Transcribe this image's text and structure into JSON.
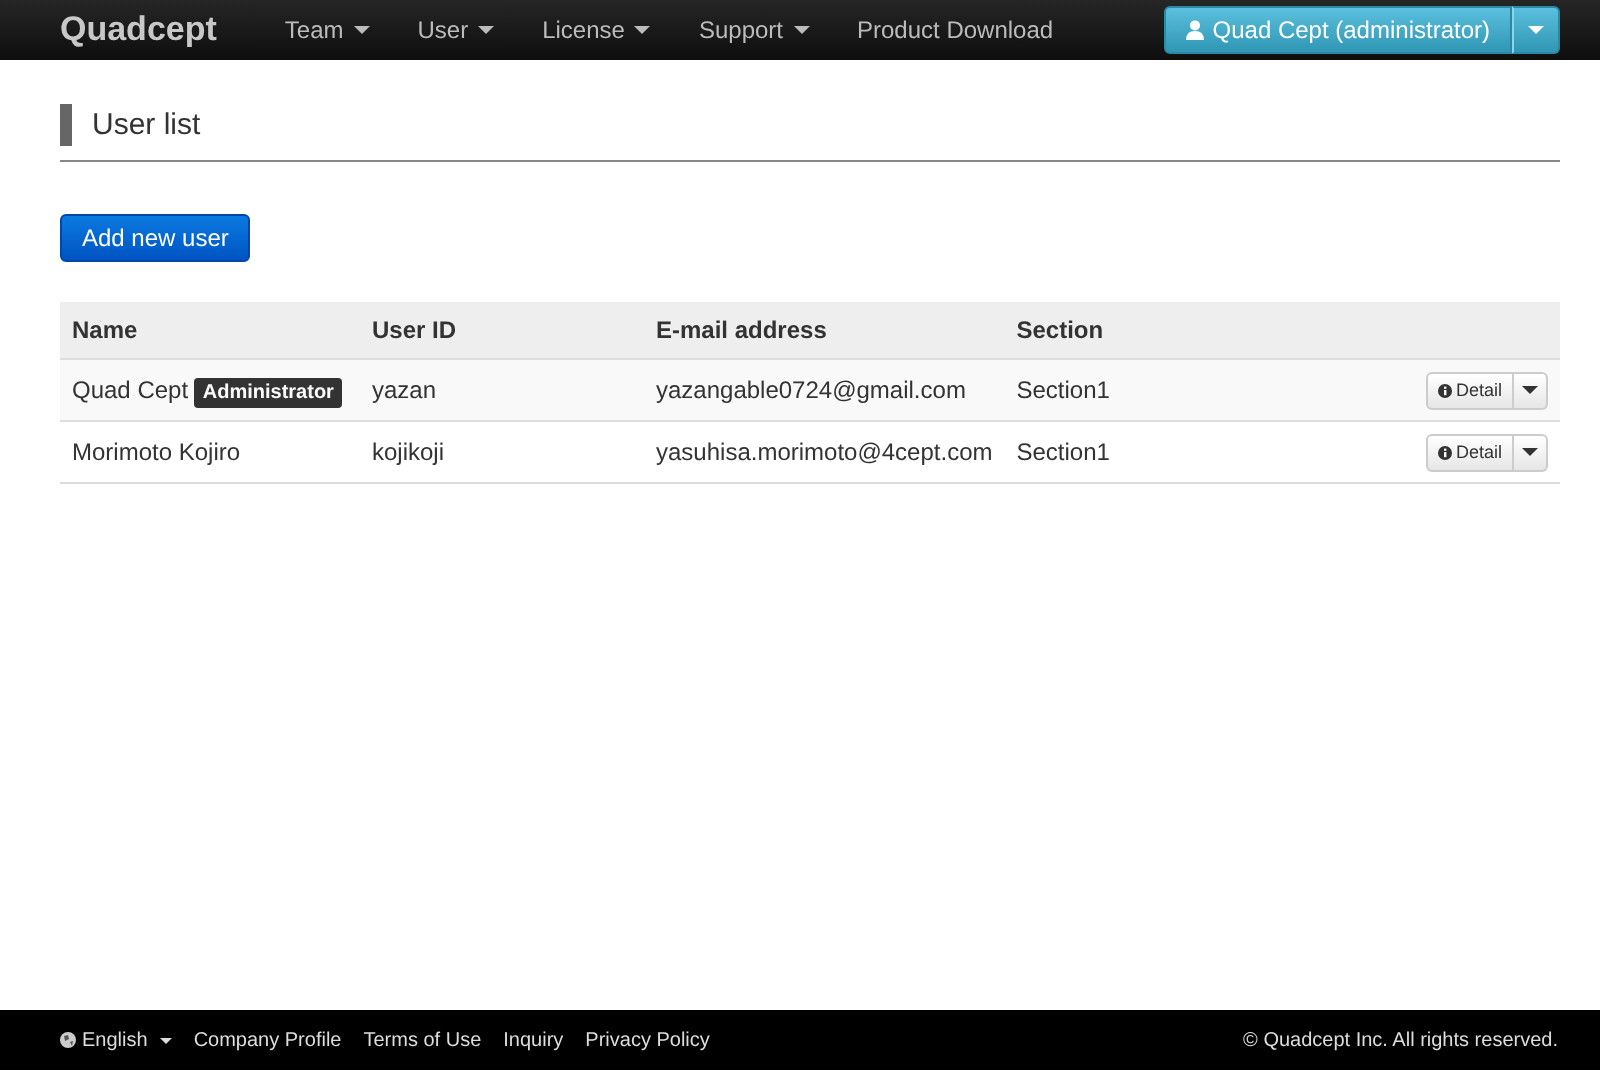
{
  "navbar": {
    "brand": "Quadcept",
    "menus": [
      {
        "label": "Team",
        "dropdown": true
      },
      {
        "label": "User",
        "dropdown": true
      },
      {
        "label": "License",
        "dropdown": true
      },
      {
        "label": "Support",
        "dropdown": true
      },
      {
        "label": "Product Download",
        "dropdown": false
      }
    ],
    "account_button": "Quad Cept (administrator)"
  },
  "page": {
    "title": "User list",
    "add_button": "Add new user"
  },
  "table": {
    "columns": [
      "Name",
      "User ID",
      "E-mail address",
      "Section"
    ],
    "rows": [
      {
        "name": "Quad Cept",
        "badge": "Administrator",
        "user_id": "yazan",
        "email": "yazangable0724@gmail.com",
        "section": "Section1",
        "action": "Detail"
      },
      {
        "name": "Morimoto Kojiro",
        "user_id": "kojikoji",
        "email": "yasuhisa.morimoto@4cept.com",
        "section": "Section1",
        "action": "Detail"
      }
    ]
  },
  "footer": {
    "language": "English",
    "links": [
      "Company Profile",
      "Terms of Use",
      "Inquiry",
      "Privacy Policy"
    ],
    "copyright": "© Quadcept Inc. All rights reserved."
  }
}
